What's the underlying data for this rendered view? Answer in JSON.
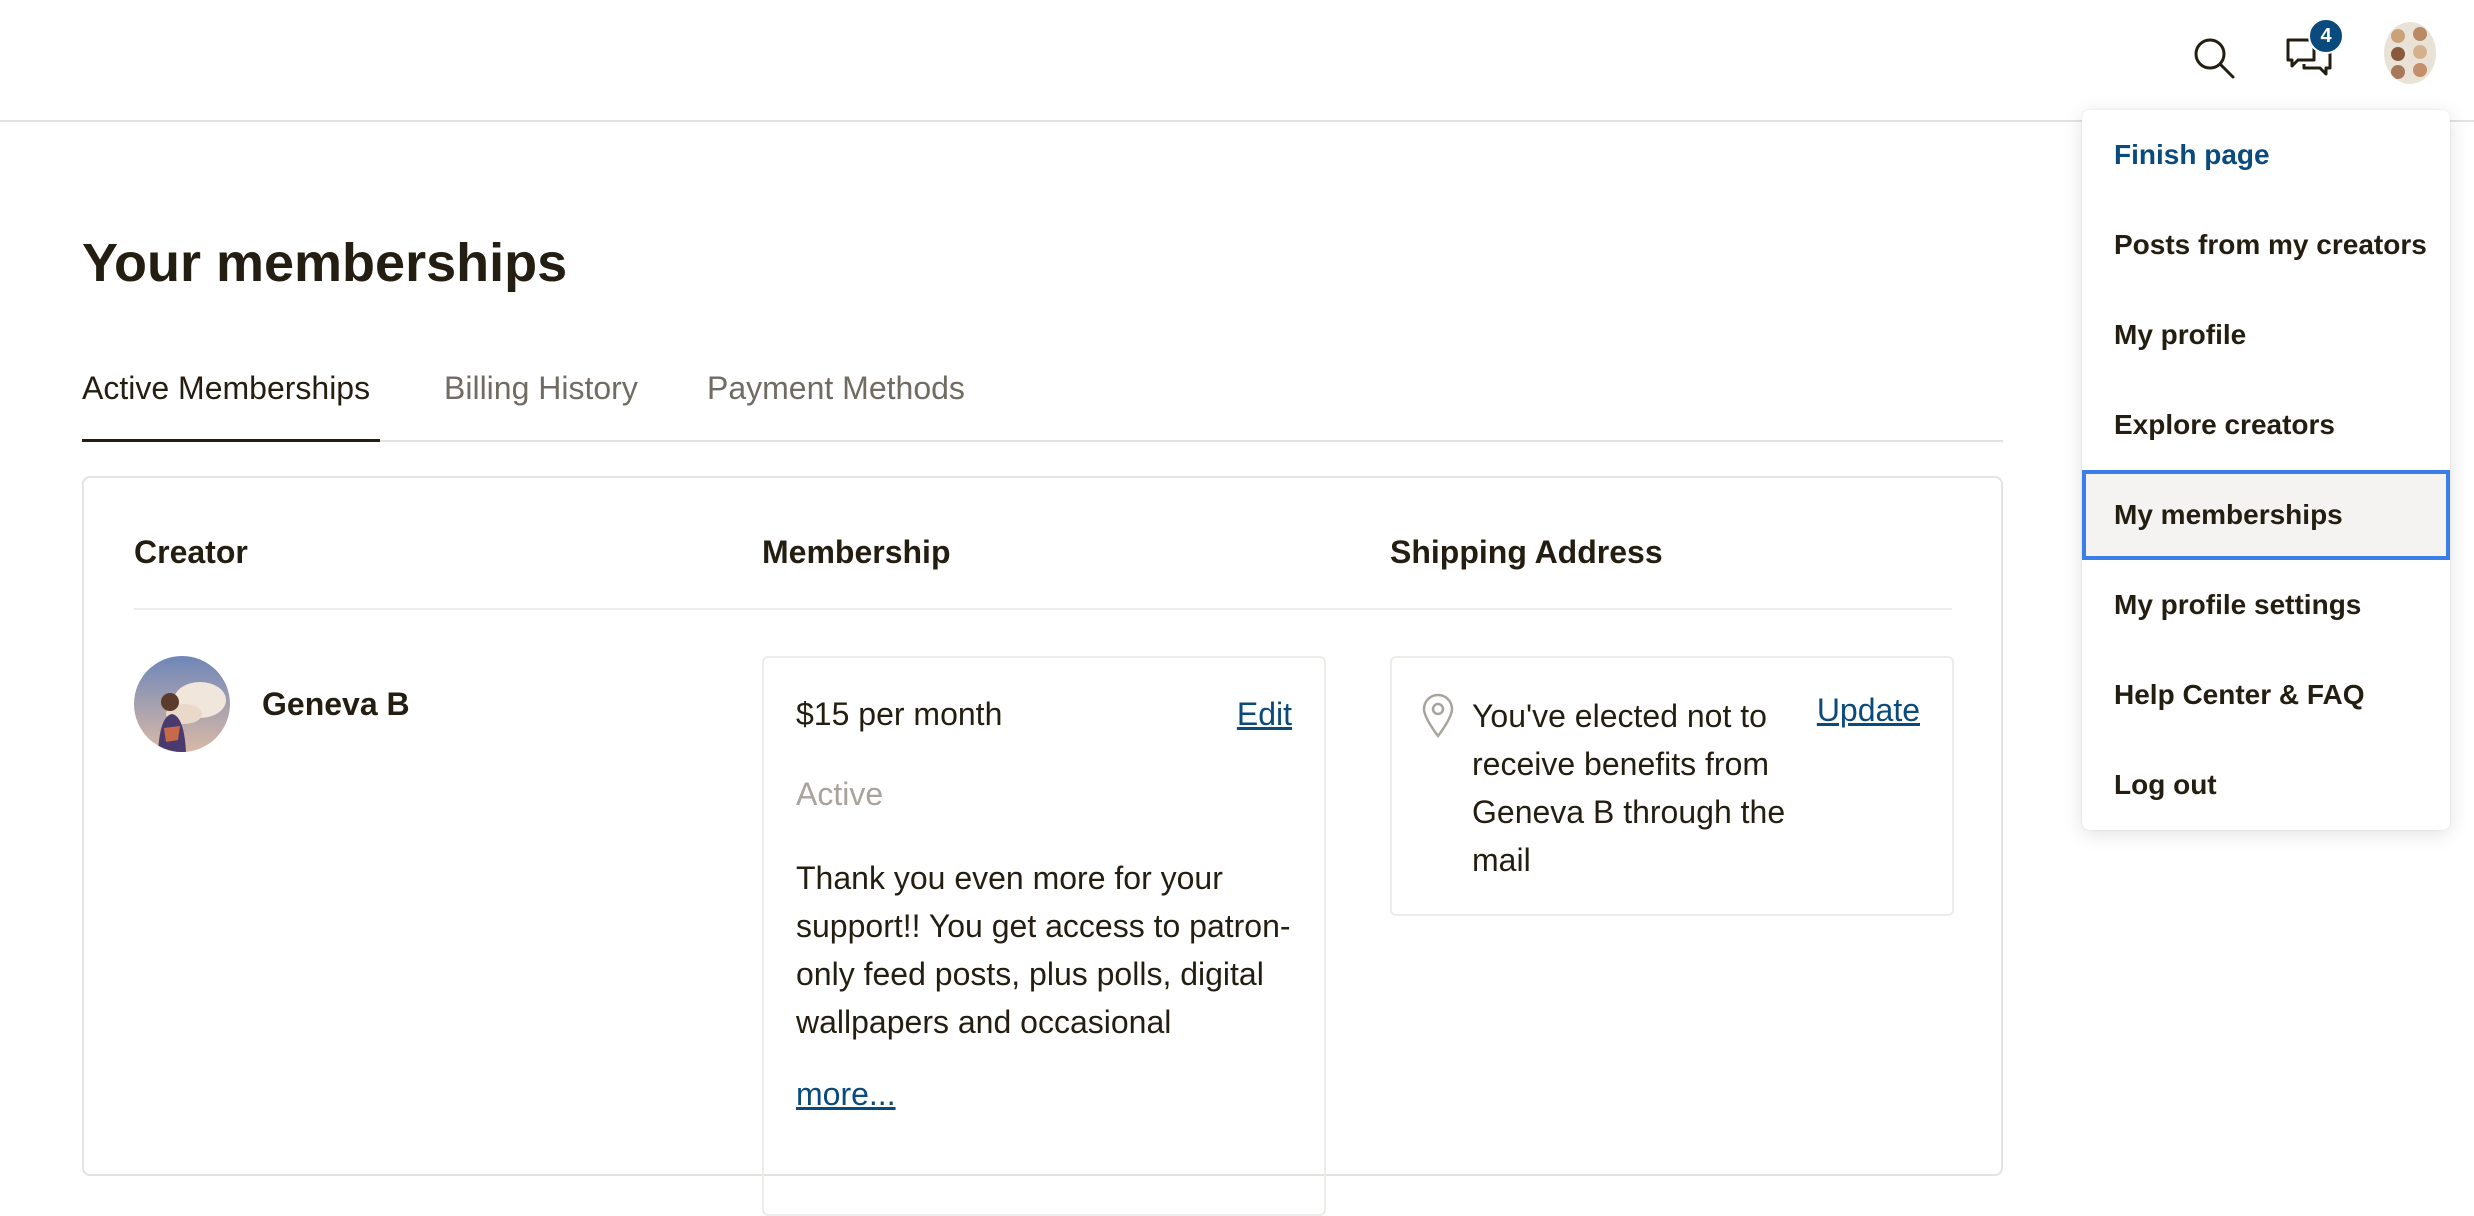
{
  "header": {
    "icons": {
      "search": "search-icon",
      "messages": "chat-bubbles-icon"
    },
    "message_badge": "4",
    "accent_color": "#0a4a7d"
  },
  "page": {
    "title": "Your memberships"
  },
  "tabs": [
    {
      "label": "Active Memberships",
      "active": true
    },
    {
      "label": "Billing History",
      "active": false
    },
    {
      "label": "Payment Methods",
      "active": false
    }
  ],
  "table": {
    "columns": [
      "Creator",
      "Membership",
      "Shipping Address"
    ],
    "row": {
      "creator_name": "Geneva B",
      "membership": {
        "price": "$15 per month",
        "edit_label": "Edit",
        "status": "Active",
        "description": "Thank you even more for your support!! You get access to patron-only feed posts, plus polls, digital wallpapers and occasional",
        "more_label": "more..."
      },
      "shipping": {
        "text": "You've elected not to receive benefits from Geneva B through the mail",
        "update_label": "Update"
      }
    }
  },
  "menu": {
    "items": [
      "Finish page",
      "Posts from my creators",
      "My profile",
      "Explore creators",
      "My memberships",
      "My profile settings",
      "Help Center & FAQ",
      "Log out"
    ],
    "selected": "My memberships",
    "selection_color": "#3b7ee8"
  }
}
